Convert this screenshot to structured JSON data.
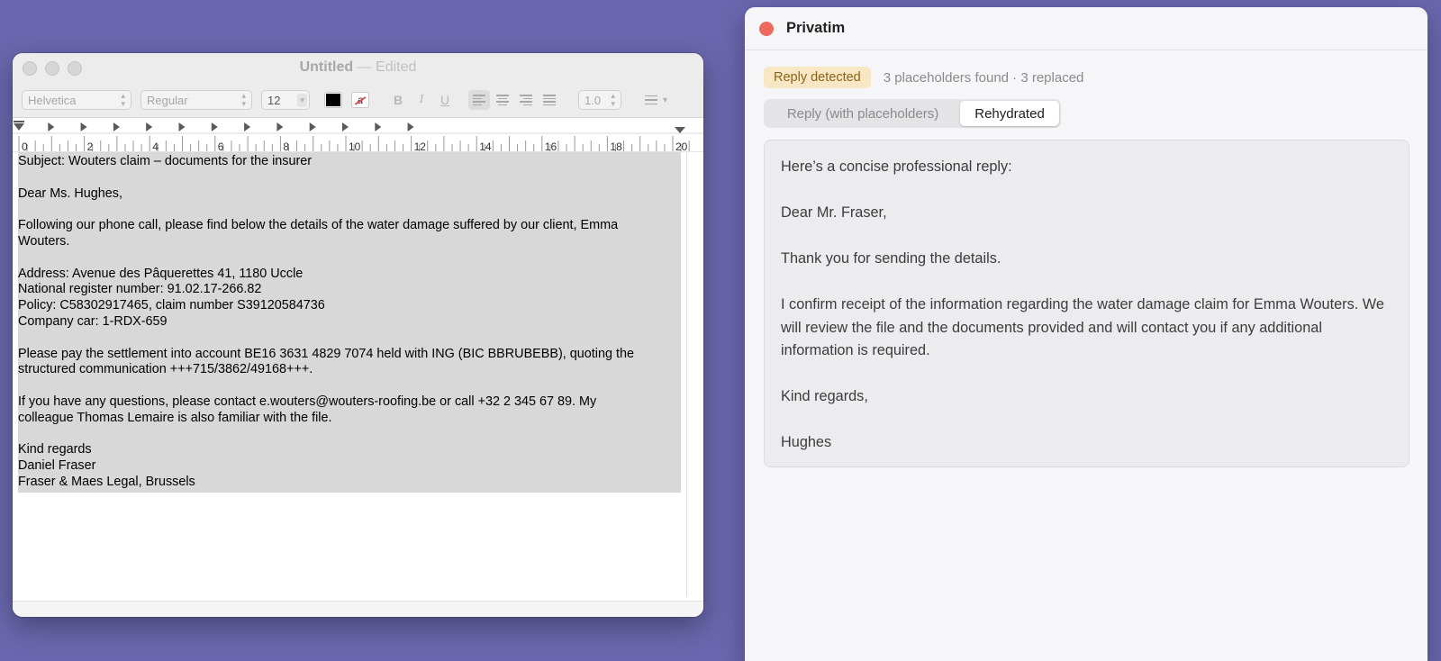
{
  "textedit": {
    "title": "Untitled",
    "title_sep": " — ",
    "title_status": "Edited",
    "toolbar": {
      "font_family": "Helvetica",
      "font_style": "Regular",
      "font_size": "12",
      "bold": "B",
      "italic": "I",
      "underline": "U",
      "line_spacing": "1.0",
      "highlight_glyph": "a"
    },
    "ruler": {
      "labels": [
        "0",
        "2",
        "4",
        "6",
        "8",
        "10",
        "12",
        "14",
        "16",
        "18",
        "20"
      ]
    },
    "document": {
      "lines": [
        "Subject: Wouters claim – documents for the insurer",
        "Dear Ms. Hughes,",
        "Following our phone call, please find below the details of the water damage suffered by our client, Emma",
        "Wouters.",
        "Address: Avenue des Pâquerettes 41, 1180 Uccle",
        "National register number: 91.02.17-266.82",
        "Policy: C58302917465, claim number S39120584736",
        "Company car: 1-RDX-659",
        "Please pay the settlement into account BE16 3631 4829 7074 held with ING (BIC BBRUBEBB), quoting the",
        "structured communication +++715/3862/49168+++.",
        "If you have any questions, please contact e.wouters@wouters-roofing.be or call +32 2 345 67 89. My",
        "colleague Thomas Lemaire is also familiar with the file.",
        "Kind regards",
        "Daniel Fraser",
        "Fraser & Maes Legal, Brussels"
      ]
    }
  },
  "privatim": {
    "title": "Privatim",
    "badge": "Reply detected",
    "summary": "3 placeholders found · 3 replaced",
    "tabs": {
      "placeholders": "Reply (with placeholders)",
      "rehydrated": "Rehydrated"
    },
    "reply": {
      "intro": "Here’s a concise professional reply:",
      "greeting": "Dear Mr. Fraser,",
      "thanks": "Thank you for sending the details.",
      "body": "I confirm receipt of the information regarding the water damage claim for Emma Wouters. We will review the file and the documents provided and will contact you if any additional information is required.",
      "closing": "Kind regards,",
      "signature": "Hughes"
    }
  },
  "colors": {
    "desktop": "#6a67ae",
    "close_red": "#ec6a5e",
    "badge_bg": "#f7e7c4",
    "badge_text": "#8a6418",
    "selection": "#d8d8d8"
  }
}
